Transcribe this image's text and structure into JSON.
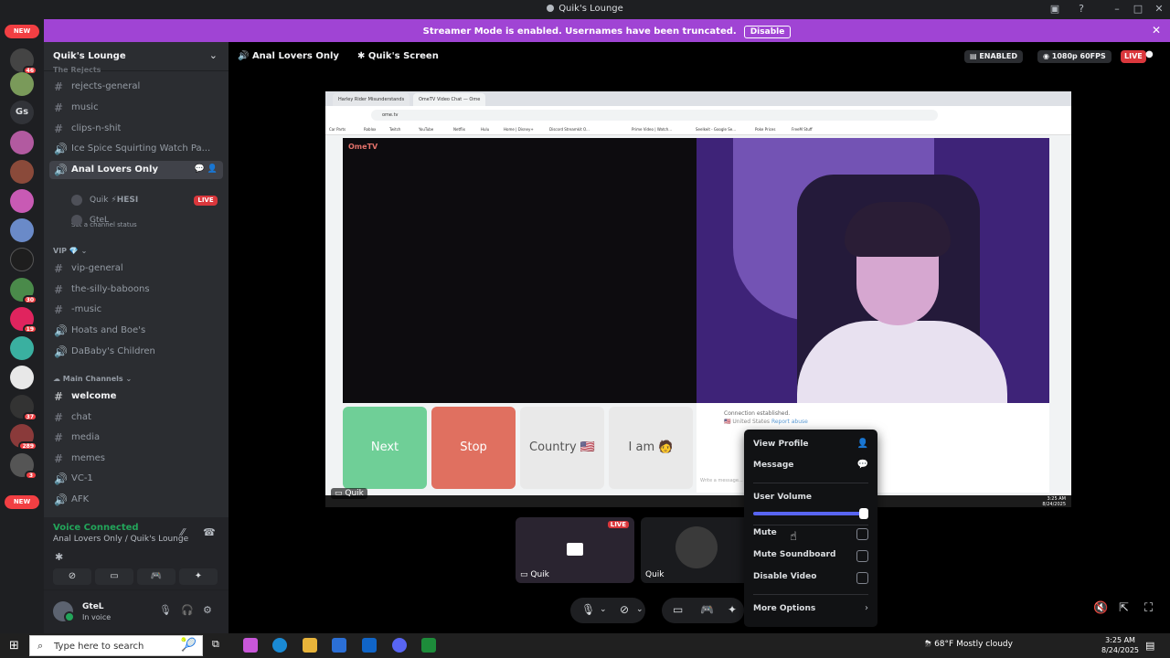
{
  "window": {
    "title": "Quik's Lounge"
  },
  "banner": {
    "text": "Streamer Mode is enabled. Usernames have been truncated.",
    "disable_label": "Disable"
  },
  "rail": {
    "new_top": "NEW",
    "new_bottom": "NEW",
    "gs_label": "Gs",
    "badges": [
      "46",
      "30",
      "19",
      "37",
      "289",
      "3"
    ]
  },
  "server": {
    "name": "Quik's Lounge"
  },
  "channels": {
    "partial_category": "The Rejects",
    "rejects_general": "rejects-general",
    "music": "music",
    "clips": "clips-n-shit",
    "ice_spice": "Ice Spice Squirting Watch Pa...",
    "active_voice": "Anal Lovers Only",
    "set_status": "Set a channel status",
    "voice_users": [
      {
        "name": "Quik",
        "tag": "HESI",
        "live": "LIVE"
      },
      {
        "name": "GteL"
      }
    ],
    "vip_category": "VIP",
    "vip_general": "vip-general",
    "silly_baboons": "the-silly-baboons",
    "music2": "-music",
    "hoats": "Hoats and Boe's",
    "dababy": "DaBaby's Children",
    "main_category": "Main Channels",
    "welcome": "welcome",
    "chat": "chat",
    "media": "media",
    "memes": "memes",
    "vc1": "VC-1",
    "afk": "AFK"
  },
  "voice": {
    "connected": "Voice Connected",
    "location": "Anal Lovers Only / Quik's Lounge"
  },
  "user": {
    "name": "GteL",
    "status": "In voice"
  },
  "stage": {
    "channel": "Anal Lovers Only",
    "screen_label": "Quik's Screen",
    "enabled": "ENABLED",
    "quality": "1080p 60FPS",
    "live": "LIVE"
  },
  "screen": {
    "tab1": "Harley Rider Misunderstands",
    "tab2": "OmeTV Video Chat — Ome",
    "url": "ome.tv",
    "bookmarks": [
      "Car Parts",
      "Roblox",
      "Twitch",
      "YouTube",
      "Netflix",
      "Hulu",
      "Home | Disney+",
      "Discord Streamkit O...",
      "Prime Video | Watch...",
      "Seelkeit - Google Se...",
      "Poke Prices",
      "FreeM Stuff"
    ],
    "logo": "OmeTV",
    "next": "Next",
    "stop": "Stop",
    "country": "Country",
    "i_am": "I am",
    "chat_msg1": "Connection established.",
    "chat_msg2_country": "United States",
    "chat_msg2_report": "Report abuse",
    "chat_placeholder": "Write a message...",
    "streamer_tag": "Quik",
    "mini_clock_time": "3:25 AM",
    "mini_clock_date": "8/24/2025"
  },
  "tiles": [
    {
      "name": "Quik",
      "live": "LIVE"
    },
    {
      "name": "Quik"
    }
  ],
  "menu": {
    "view_profile": "View Profile",
    "message": "Message",
    "user_volume": "User Volume",
    "volume": 1.0,
    "mute": "Mute",
    "mute_soundboard": "Mute Soundboard",
    "disable_video": "Disable Video",
    "more_options": "More Options"
  },
  "taskbar": {
    "search_placeholder": "Type here to search",
    "weather_temp": "68°F",
    "weather_desc": "Mostly cloudy",
    "time": "3:25 AM",
    "date": "8/24/2025"
  },
  "colors": {
    "banner": "#a044d4",
    "voice_connected": "#23a55a",
    "live": "#da373c",
    "next_btn": "#6fcf97",
    "stop_btn": "#e07060",
    "blurple": "#5865f2"
  }
}
